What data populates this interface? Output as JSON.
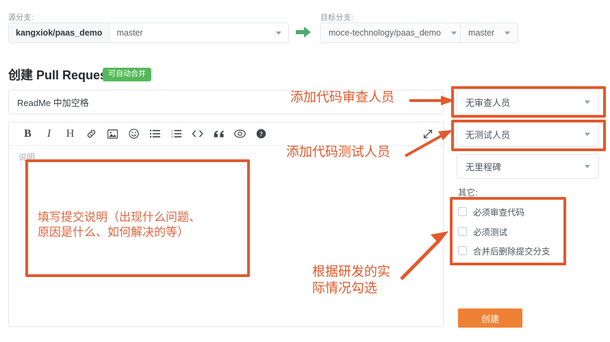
{
  "branch_bar": {
    "source_label": "源分支:",
    "target_label": "目标分支:",
    "source_repo": "kangxiok/paas_demo",
    "source_branch": "master",
    "target_repo": "moce-technology/paas_demo",
    "target_branch": "master",
    "arrow_icon": "green-arrow-right-icon"
  },
  "header": {
    "title": "创建 Pull Request",
    "merge_badge": "可自动合并"
  },
  "form": {
    "title_value": "ReadMe 中加空格",
    "editor_placeholder": "说明"
  },
  "toolbar": {
    "items": [
      {
        "name": "bold-icon",
        "glyph": "B"
      },
      {
        "name": "italic-icon",
        "glyph": "I"
      },
      {
        "name": "heading-icon",
        "glyph": "H"
      },
      {
        "name": "link-icon",
        "glyph": ""
      },
      {
        "name": "image-icon",
        "glyph": ""
      },
      {
        "name": "emoji-icon",
        "glyph": ""
      },
      {
        "name": "unordered-list-icon",
        "glyph": ""
      },
      {
        "name": "ordered-list-icon",
        "glyph": ""
      },
      {
        "name": "code-icon",
        "glyph": ""
      },
      {
        "name": "quote-icon",
        "glyph": ""
      },
      {
        "name": "preview-eye-icon",
        "glyph": ""
      },
      {
        "name": "help-icon",
        "glyph": ""
      }
    ],
    "expand_icon": "expand-fullscreen-icon"
  },
  "sidebar": {
    "reviewer_select": "无审查人员",
    "tester_select": "无测试人员",
    "milestone_select": "无里程碑",
    "other_label": "其它:",
    "checkboxes": [
      {
        "label": "必须审查代码",
        "checked": false
      },
      {
        "label": "必须测试",
        "checked": false
      },
      {
        "label": "合并后删除提交分支",
        "checked": false
      }
    ],
    "create_button": "创建"
  },
  "annotations": {
    "reviewer": "添加代码审查人员",
    "tester": "添加代码测试人员",
    "description": "填写提交说明（出现什么问题、\n原因是什么、如何解决的等）",
    "checkbox": "根据研发的实\n际情况勾选",
    "color": "#e2592c"
  },
  "colors": {
    "accent_orange": "#ef8135",
    "badge_green": "#55b95a",
    "annotation_orange": "#e2592c",
    "border_gray": "#e3e6ea"
  }
}
